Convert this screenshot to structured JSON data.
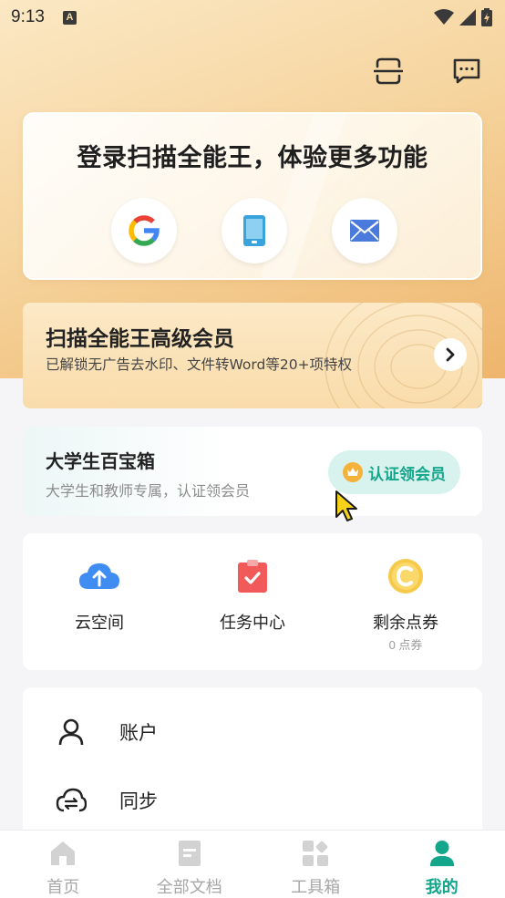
{
  "status_bar": {
    "time": "9:13",
    "notification_icon": "A"
  },
  "header": {
    "icons": [
      "scan-icon",
      "message-icon"
    ]
  },
  "login_card": {
    "title": "登录扫描全能王，体验更多功能",
    "options": [
      "google-icon",
      "phone-icon",
      "email-icon"
    ]
  },
  "vip_card": {
    "title": "扫描全能王高级会员",
    "subtitle": "已解锁无广告去水印、文件转Word等20+项特权"
  },
  "student_card": {
    "title": "大学生百宝箱",
    "subtitle": "大学生和教师专属，认证领会员",
    "button_label": "认证领会员"
  },
  "quick_actions": [
    {
      "label": "云空间",
      "icon": "cloud-upload-icon"
    },
    {
      "label": "任务中心",
      "icon": "task-icon"
    },
    {
      "label": "剩余点券",
      "icon": "coupon-icon",
      "sublabel": "0 点券"
    }
  ],
  "menu": [
    {
      "label": "账户",
      "icon": "account-icon"
    },
    {
      "label": "同步",
      "icon": "sync-icon"
    }
  ],
  "tabs": [
    {
      "label": "首页",
      "icon": "home-icon",
      "active": false
    },
    {
      "label": "全部文档",
      "icon": "documents-icon",
      "active": false
    },
    {
      "label": "工具箱",
      "icon": "toolbox-icon",
      "active": false
    },
    {
      "label": "我的",
      "icon": "profile-icon",
      "active": true
    }
  ],
  "colors": {
    "accent": "#14a68b",
    "gold": "#f5b23b",
    "hero": "#f6d59f"
  }
}
